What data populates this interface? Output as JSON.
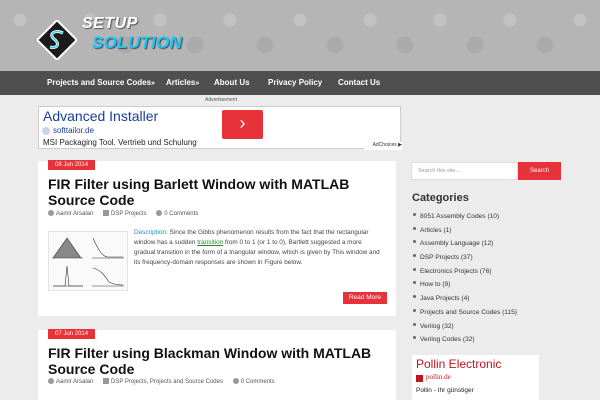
{
  "logo": {
    "line1": "SETUP",
    "line2": "SOLUTION"
  },
  "nav": [
    {
      "label": "Projects and Source Codes",
      "arrow": "»"
    },
    {
      "label": "Articles",
      "arrow": "»"
    },
    {
      "label": "About Us",
      "arrow": ""
    },
    {
      "label": "Privacy Policy",
      "arrow": ""
    },
    {
      "label": "Contact Us",
      "arrow": ""
    }
  ],
  "ad": {
    "label": "Advertisement",
    "title": "Advanced Installer",
    "url": "softtailor.de",
    "description": "MSI Packaging Tool. Vertrieb und Schulung",
    "arrow": "›",
    "adchoices": "AdChoices ▶"
  },
  "posts": [
    {
      "date": "08 Jun 2014",
      "title": "FIR Filter using Barlett Window with MATLAB Source Code",
      "author": "Aamir Arsalan",
      "categories": "DSP Projects",
      "comments": "0 Comments",
      "excerpt_link": "Description:",
      "excerpt_a": " Since the Gibbs phenomenon results from the fact that the rectangular window has a sudden ",
      "excerpt_link2": "transition",
      "excerpt_b": " from 0 to 1 (or 1 to 0), Bartlett suggested a more gradual transition in the form of a triangular window, which is given by This window and its frequency-domain responses are shown in Figure below.",
      "read_more": "Read More"
    },
    {
      "date": "07 Jun 2014",
      "title": "FIR Filter using Blackman Window with MATLAB Source Code",
      "author": "Aamir Arsalan",
      "categories": "DSP Projects, Projects and Source Codes",
      "comments": "0 Comments"
    }
  ],
  "sidebar": {
    "search_placeholder": "Search this site...",
    "search_button": "Search",
    "categories_heading": "Categories",
    "categories": [
      "8051 Assembly Codes (10)",
      "Articles (1)",
      "Assembly Language (12)",
      "DSP Projects (37)",
      "Electronics Projects (76)",
      "How to (9)",
      "Java Projects (4)",
      "Projects and Source Codes (115)",
      "Verilog (32)",
      "Verilog Codes (32)"
    ],
    "pollin": {
      "title": "Pollin Electronic",
      "url": "pollin.de",
      "desc": "Pollin - Ihr günstiger"
    }
  },
  "colors": {
    "accent": "#e8323a",
    "nav_bg": "#4f4f4f",
    "logo_blue": "#1ec6f0"
  }
}
